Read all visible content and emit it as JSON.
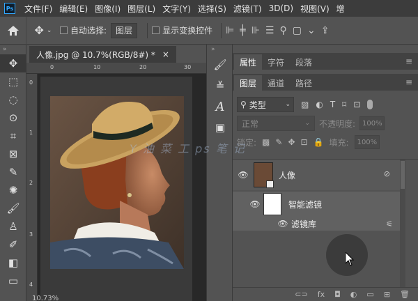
{
  "app": {
    "logo": "Ps"
  },
  "menu": [
    "文件(F)",
    "编辑(E)",
    "图像(I)",
    "图层(L)",
    "文字(Y)",
    "选择(S)",
    "滤镜(T)",
    "3D(D)",
    "视图(V)",
    "增"
  ],
  "options": {
    "auto_select_label": "自动选择:",
    "auto_select_target": "图层",
    "show_transform_label": "显示变换控件"
  },
  "document": {
    "tab_title": "人像.jpg @ 10.7%(RGB/8#) *",
    "tab_close": "×",
    "ruler_top": [
      "0",
      "10",
      "20",
      "30"
    ],
    "ruler_left": [
      "0",
      "1",
      "2",
      "3",
      "4"
    ],
    "zoom_status": "10.73%"
  },
  "panels": {
    "top_tabs": [
      {
        "label": "属性",
        "active": true
      },
      {
        "label": "字符",
        "active": false
      },
      {
        "label": "段落",
        "active": false
      }
    ],
    "layer_tabs": [
      {
        "label": "图层",
        "active": true
      },
      {
        "label": "通道",
        "active": false
      },
      {
        "label": "路径",
        "active": false
      }
    ],
    "menu_icon": "≡",
    "filter_kind": "类型",
    "blend_mode": "正常",
    "opacity_label": "不透明度:",
    "opacity_value": "100%",
    "lock_label": "锁定:",
    "fill_label": "填充:",
    "fill_value": "100%"
  },
  "layers": [
    {
      "name": "人像",
      "type": "smart-object"
    },
    {
      "name": "智能滤镜",
      "type": "smart-filter"
    },
    {
      "name": "滤镜库",
      "type": "filter"
    }
  ],
  "watermark": "Y 油 菜 ⼯ ps 笔 记"
}
